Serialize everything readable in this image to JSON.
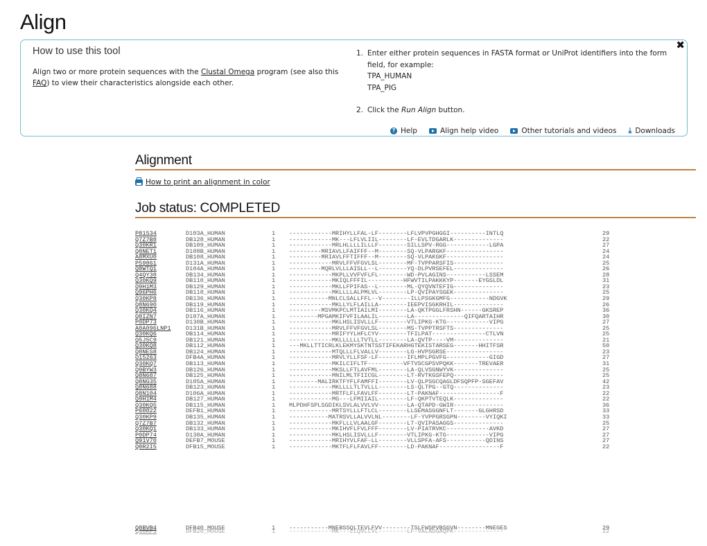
{
  "page": {
    "title": "Align"
  },
  "help": {
    "title": "How to use this tool",
    "desc_prefix": "Align two or more protein sequences with the ",
    "desc_link1": "Clustal Omega",
    "desc_mid": " program (see also this ",
    "desc_link2": "FAQ",
    "desc_suffix": ") to view their characteristics alongside each other.",
    "step1_num": "1.",
    "step1_text": "Enter either protein sequences in FASTA format or UniProt identifiers into the form field, for example:",
    "example1": "TPA_HUMAN",
    "example2": "TPA_PIG",
    "step2_num": "2.",
    "step2_prefix": "Click the ",
    "step2_em": "Run Align",
    "step2_suffix": " button.",
    "close_icon": "close-icon",
    "links": [
      {
        "icon": "help-icon",
        "label": "Help"
      },
      {
        "icon": "video-icon",
        "label": "Align help video"
      },
      {
        "icon": "video-icon",
        "label": "Other tutorials and videos"
      },
      {
        "icon": "download-icon",
        "label": "Downloads"
      }
    ]
  },
  "alignment": {
    "heading": "Alignment",
    "print_link": "How to print an alignment in color"
  },
  "job": {
    "heading": "Job status: COMPLETED"
  },
  "rows": [
    {
      "id": "P81534",
      "name": "D103A_HUMAN",
      "start": "1",
      "seq": "------------MRIHYLLFAL-LF--------LFLVPVPGHGGI----------INTLQ",
      "end": "29"
    },
    {
      "id": "Q7Z7B8",
      "name": "DB128_HUMAN",
      "start": "1",
      "seq": "------------MK---LFLVLIIL--------LF-EVLTDGARLK--------------",
      "end": "22"
    },
    {
      "id": "Q30KR1",
      "name": "DB109_HUMAN",
      "start": "1",
      "seq": "------------MRLHLLLLILLLF--------SILLSPV-RGG------------LGPA",
      "end": "27"
    },
    {
      "id": "Q8NET1",
      "name": "D108B_HUMAN",
      "start": "1",
      "seq": "---------MRIAVLLFAIFFF--M--------SQ-VLPARGKF----------------",
      "end": "24"
    },
    {
      "id": "A8MXU0",
      "name": "DB108_HUMAN",
      "start": "1",
      "seq": "---------MRIAVLFFTIFFF--M--------SQ-VLPAKGKF----------------",
      "end": "24"
    },
    {
      "id": "P59861",
      "name": "D131A_HUMAN",
      "start": "1",
      "seq": "------------MRVLFFVFGVLSL--------MF-TVPPARSFIS--------------",
      "end": "25"
    },
    {
      "id": "Q8WTQ1",
      "name": "D104A_HUMAN",
      "start": "1",
      "seq": "---------MQRLVLLLAISLL--L--------YQ-DLPVRSEFEL--------------",
      "end": "26"
    },
    {
      "id": "Q4QY38",
      "name": "DB134_HUMAN",
      "start": "1",
      "seq": "------------MKPLLVVFVFLFL--------WD-PVLAGINS-----------LSSEM",
      "end": "28"
    },
    {
      "id": "Q30KQ9",
      "name": "DB110_HUMAN",
      "start": "1",
      "seq": "------------MKIQLFFFIL----------HFWVTILPAKKKYP-------EYGSLDL",
      "end": "31"
    },
    {
      "id": "Q9H1M3",
      "name": "DB129_HUMAN",
      "start": "1",
      "seq": "------------MKLLFPIFAS--L--------ML-QYQVNTEFIG--------------",
      "end": "23"
    },
    {
      "id": "Q96PH6",
      "name": "DB118_HUMAN",
      "start": "1",
      "seq": "------------MKLLLLALPMLVL--------LP-QVIPAYSGEK--------------",
      "end": "25"
    },
    {
      "id": "Q30KP8",
      "name": "DB136_HUMAN",
      "start": "1",
      "seq": "-----------MNLCLSALLFFL--V--------ILLPSGKGMFG-----------NDGVK",
      "end": "29"
    },
    {
      "id": "Q8N690",
      "name": "DB119_HUMAN",
      "start": "1",
      "seq": "------------MKLLYLFLAILLA--------IEEPVISGKRHIL--------------",
      "end": "26"
    },
    {
      "id": "Q30KQ4",
      "name": "DB116_HUMAN",
      "start": "1",
      "seq": "---------MSVMKPCLMTIAILMI--------LA-QKTPGGLFRSHN------GKSREP",
      "end": "36"
    },
    {
      "id": "Q8IZN7",
      "name": "D107A_HUMAN",
      "start": "1",
      "seq": "--------MPGAMKIFVFILAALIL--------LA--------------QIFQARTAIHR",
      "end": "30"
    },
    {
      "id": "P0DP73",
      "name": "D130B_HUMAN",
      "start": "1",
      "seq": "------------MKLHSLISVLLLF--------VTLIPKG-KTG------------VIPG",
      "end": "27"
    },
    {
      "id": "A0A096LNP1",
      "name": "D131B_HUMAN",
      "start": "1",
      "seq": "------------MRVLFFVFGVLSL--------MS-TVPPTRSFTS--------------",
      "end": "25"
    },
    {
      "id": "Q30KQ6",
      "name": "DB114_HUMAN",
      "start": "1",
      "seq": "------------MRIFYYLHFLCYV--------TFILPAT---------------CTLVN",
      "end": "25"
    },
    {
      "id": "Q5J5C9",
      "name": "DB121_HUMAN",
      "start": "1",
      "seq": "------------MKLLLLLLTVTLL--------LA-QVTP----VM--------------",
      "end": "21"
    },
    {
      "id": "Q30KQ8",
      "name": "DB112_HUMAN",
      "start": "1",
      "seq": "---MKLLTTICRLKLEKMYSKTNTSSTIFEKARHGTEKISTARSEG-------HHITFSR",
      "end": "50"
    },
    {
      "id": "Q8NES8",
      "name": "DB124_HUMAN",
      "start": "1",
      "seq": "------------MTQLLLFLVALLV--------LG-HVPSGRSE----------------",
      "end": "23"
    },
    {
      "id": "O15263",
      "name": "DFB4A_HUMAN",
      "start": "1",
      "seq": "------------MRVLYLLFSF-LF--------IFLMPLPGVFG------------GIGD",
      "end": "27"
    },
    {
      "id": "Q30KQ7",
      "name": "DB113_HUMAN",
      "start": "1",
      "seq": "------------MKILCIFLTF----------VFTVSCGPSVPQKK-------TREVAER",
      "end": "31"
    },
    {
      "id": "Q9BYW3",
      "name": "DB126_HUMAN",
      "start": "1",
      "seq": "------------MKSLLFTLAVFML--------LA-QLVSGNWYVK--------------",
      "end": "25"
    },
    {
      "id": "Q8N687",
      "name": "DB125_HUMAN",
      "start": "1",
      "seq": "------------MNILMLTFIICGL--------LT-RVTKGSFEPQ--------------",
      "end": "25"
    },
    {
      "id": "Q8NG35",
      "name": "D105A_HUMAN",
      "start": "1",
      "seq": "--------MALIRKTFYFLFAMFFI--------LV-QLPSGCQAGLDFSQPFP-SGEFAV",
      "end": "42"
    },
    {
      "id": "Q8N688",
      "name": "DB123_HUMAN",
      "start": "1",
      "seq": "------------MKLLLLTLTVLLL--------LS-QLTPG--GTQ--------------",
      "end": "23"
    },
    {
      "id": "Q8N104",
      "name": "D106A_HUMAN",
      "start": "1",
      "seq": "------------MRTFLFLFAVLFF--------LT-PAKNAF-----------------F",
      "end": "22"
    },
    {
      "id": "Q9H1M4",
      "name": "DB127_HUMAN",
      "start": "1",
      "seq": "------------MG---LFMIIAIL--------LF-QKPTVTEQLK--------------",
      "end": "22"
    },
    {
      "id": "Q30KQ5",
      "name": "DB115_HUMAN",
      "start": "1",
      "seq": "MLPDHFSPLSGDIKLSVLALVVLVV--------LA-QTAPD-GWIR--------------",
      "end": "36"
    },
    {
      "id": "P60022",
      "name": "DEFB1_HUMAN",
      "start": "1",
      "seq": "------------MRTSYLLLFTLCL--------LLSEMASGGNFLT-------GLGHRSD",
      "end": "33"
    },
    {
      "id": "Q30KP9",
      "name": "DB135_HUMAN",
      "start": "1",
      "seq": "-----------MATRSVLLALVVLNL--------LF-YVPPGRSGPN--------VYIQKI",
      "end": "33"
    },
    {
      "id": "Q7Z7B7",
      "name": "DB132_HUMAN",
      "start": "1",
      "seq": "------------MKFLLLVLAALGF--------LT-QVIPASAGGS--------------",
      "end": "25"
    },
    {
      "id": "Q30KQ1",
      "name": "DB133_HUMAN",
      "start": "1",
      "seq": "------------MKIHVFLFVLFFF--------LV-PIATRVKC------------AVKD",
      "end": "27"
    },
    {
      "id": "P0DP74",
      "name": "D130A_HUMAN",
      "start": "1",
      "seq": "------------MKLHSLISVLLLF--------VTLIPKG-KTG------------VIPG",
      "end": "27"
    },
    {
      "id": "Q91V70",
      "name": "DEFB7_MOUSE",
      "start": "1",
      "seq": "------------MRIHYVLFAF-LL--------VLLSPFA-AFS-----------QDINS",
      "end": "27"
    },
    {
      "id": "Q8R2I5",
      "name": "DFB15_MOUSE",
      "start": "1",
      "seq": "------------MKTFLFLFAVLFF--------LD-PAKNAF-----------------F",
      "end": "22"
    }
  ],
  "overlap_rows": [
    {
      "id": "Q8BVB4",
      "name": "DFB40_MOUSE",
      "start": "1",
      "seq": "-----------MNEBSSQLTEVLFVV--------TSLFWSPVBSGVN--------MNEGES",
      "end": "29"
    },
    {
      "id": "Q30KP3",
      "name": "DFB20_MOUSE",
      "start": "1",
      "seq": "------------MK---LLQVLLVL--------LF-VALADGAQPK--------------",
      "end": "22"
    }
  ]
}
